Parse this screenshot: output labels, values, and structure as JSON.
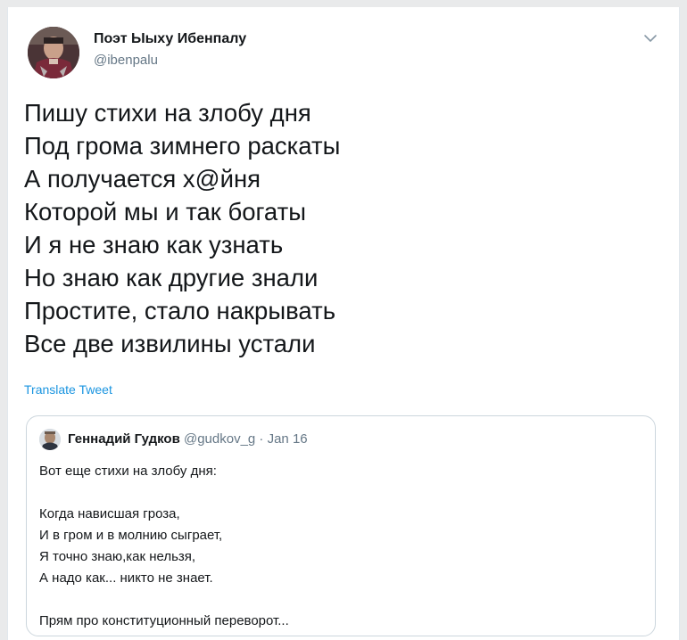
{
  "tweet": {
    "author_name": "Поэт Ыыху Ибенпалу",
    "author_handle": "@ibenpalu",
    "lines": [
      "Пишу стихи на злобу дня",
      "Под грома зимнего раскаты",
      "А получается х@йня",
      "Которой мы и так богаты",
      "И я не знаю как узнать",
      "Но знаю как другие знали",
      "Простите, стало накрывать",
      "Все две извилины устали"
    ],
    "translate_label": "Translate Tweet",
    "menu_icon": "chevron-down-icon"
  },
  "quoted": {
    "author_name": "Геннадий Гудков",
    "author_handle": "@gudkov_g",
    "separator": " · ",
    "date": "Jan 16",
    "intro": "Вот еще стихи на злобу дня:",
    "poem_lines": [
      "Когда нависшая гроза,",
      "И в гром и в молнию сыграет,",
      "Я точно знаю,как нельзя,",
      "А надо как... никто не знает."
    ],
    "closing": "Прям про конституционный переворот..."
  },
  "colors": {
    "link": "#1b95e0",
    "secondary_text": "#657786",
    "primary_text": "#14171a",
    "border": "#ccd6dd"
  }
}
